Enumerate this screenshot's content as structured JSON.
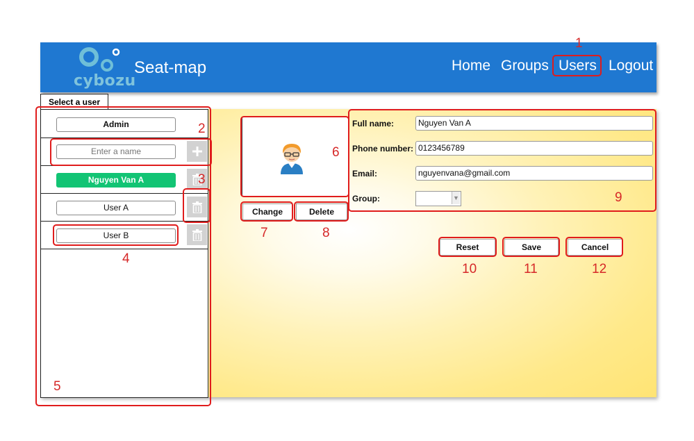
{
  "header": {
    "logo_text": "cybozu",
    "app_title": "Seat-map",
    "nav": [
      "Home",
      "Groups",
      "Users",
      "Logout"
    ],
    "brand_color": "#1f78d1"
  },
  "user_panel": {
    "tab_label": "Select a user",
    "users": [
      "Admin",
      "Nguyen Van A",
      "User A",
      "User B"
    ],
    "active_user": "Nguyen Van A",
    "active_color": "#12c474",
    "name_placeholder": "Enter a name",
    "add_icon": "plus-icon",
    "delete_icon": "trash-icon"
  },
  "avatar": {
    "icon": "user-avatar-icon",
    "change_label": "Change",
    "delete_label": "Delete"
  },
  "form": {
    "full_name_label": "Full name:",
    "full_name_value": "Nguyen Van A",
    "phone_label": "Phone number:",
    "phone_value": "0123456789",
    "email_label": "Email:",
    "email_value": "nguyenvana@gmail.com",
    "group_label": "Group:",
    "group_value": ""
  },
  "actions": {
    "reset_label": "Reset",
    "save_label": "Save",
    "cancel_label": "Cancel"
  },
  "annotations": [
    "1",
    "2",
    "3",
    "4",
    "5",
    "6",
    "7",
    "8",
    "9",
    "10",
    "11",
    "12"
  ],
  "annotation_color": "#e01c1c"
}
